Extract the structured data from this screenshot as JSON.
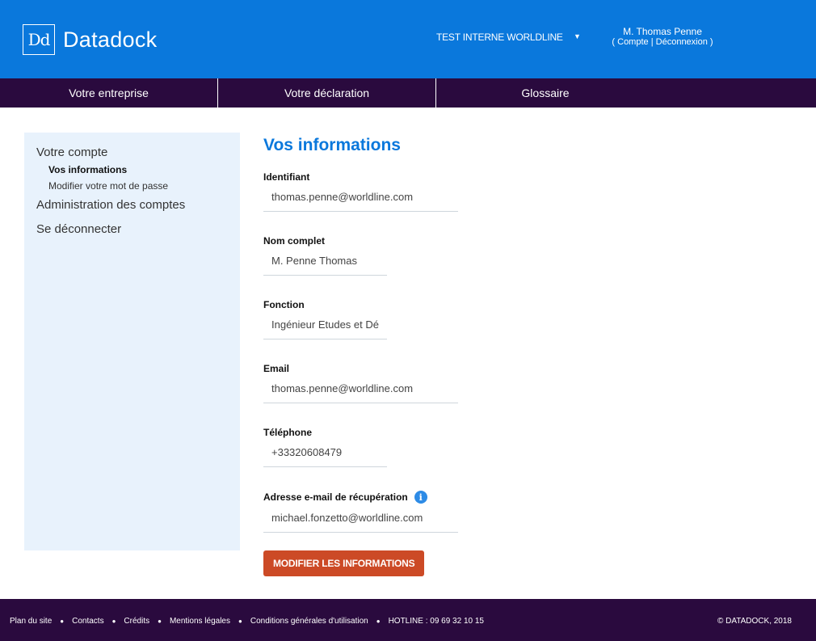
{
  "header": {
    "logo_mark": "Dd",
    "logo_text": "Datadock",
    "organization": "TEST INTERNE WORLDLINE",
    "caret": "▼",
    "user_name": "M. Thomas Penne",
    "user_links": {
      "open": "( ",
      "account": "Compte",
      "separator": "  | ",
      "logout": "Déconnexion",
      "close": " )"
    }
  },
  "nav": {
    "items": [
      {
        "label": "Votre entreprise"
      },
      {
        "label": "Votre déclaration"
      },
      {
        "label": "Glossaire"
      }
    ]
  },
  "sidebar": {
    "section_account": "Votre compte",
    "sub_info": "Vos informations",
    "sub_password": "Modifier votre mot de passe",
    "section_admin": "Administration des comptes",
    "section_logout": "Se déconnecter"
  },
  "main": {
    "title": "Vos informations",
    "fields": {
      "identifiant": {
        "label": "Identifiant",
        "value": "thomas.penne@worldline.com"
      },
      "nom": {
        "label": "Nom complet",
        "value": "M. Penne Thomas"
      },
      "fonction": {
        "label": "Fonction",
        "value": "Ingénieur Etudes et Dé"
      },
      "email": {
        "label": "Email",
        "value": "thomas.penne@worldline.com"
      },
      "telephone": {
        "label": "Téléphone",
        "value": "+33320608479"
      },
      "recuperation": {
        "label": "Adresse e-mail de récupération",
        "value": "michael.fonzetto@worldline.com",
        "icon": "i"
      }
    },
    "submit_label": "MODIFIER LES INFORMATIONS"
  },
  "footer": {
    "links": [
      {
        "label": "Plan du site"
      },
      {
        "label": "Contacts"
      },
      {
        "label": "Crédits"
      },
      {
        "label": "Mentions légales"
      },
      {
        "label": "Conditions générales d'utilisation"
      }
    ],
    "separator": "●",
    "hotline": "HOTLINE : 09 69 32 10 15",
    "copyright": "© DATADOCK, 2018"
  },
  "colors": {
    "header_bg": "#0a78dc",
    "nav_bg": "#2a0a3e",
    "sidebar_bg": "#e8f2fc",
    "button_bg": "#cc4a26",
    "title_color": "#0a78dc"
  }
}
